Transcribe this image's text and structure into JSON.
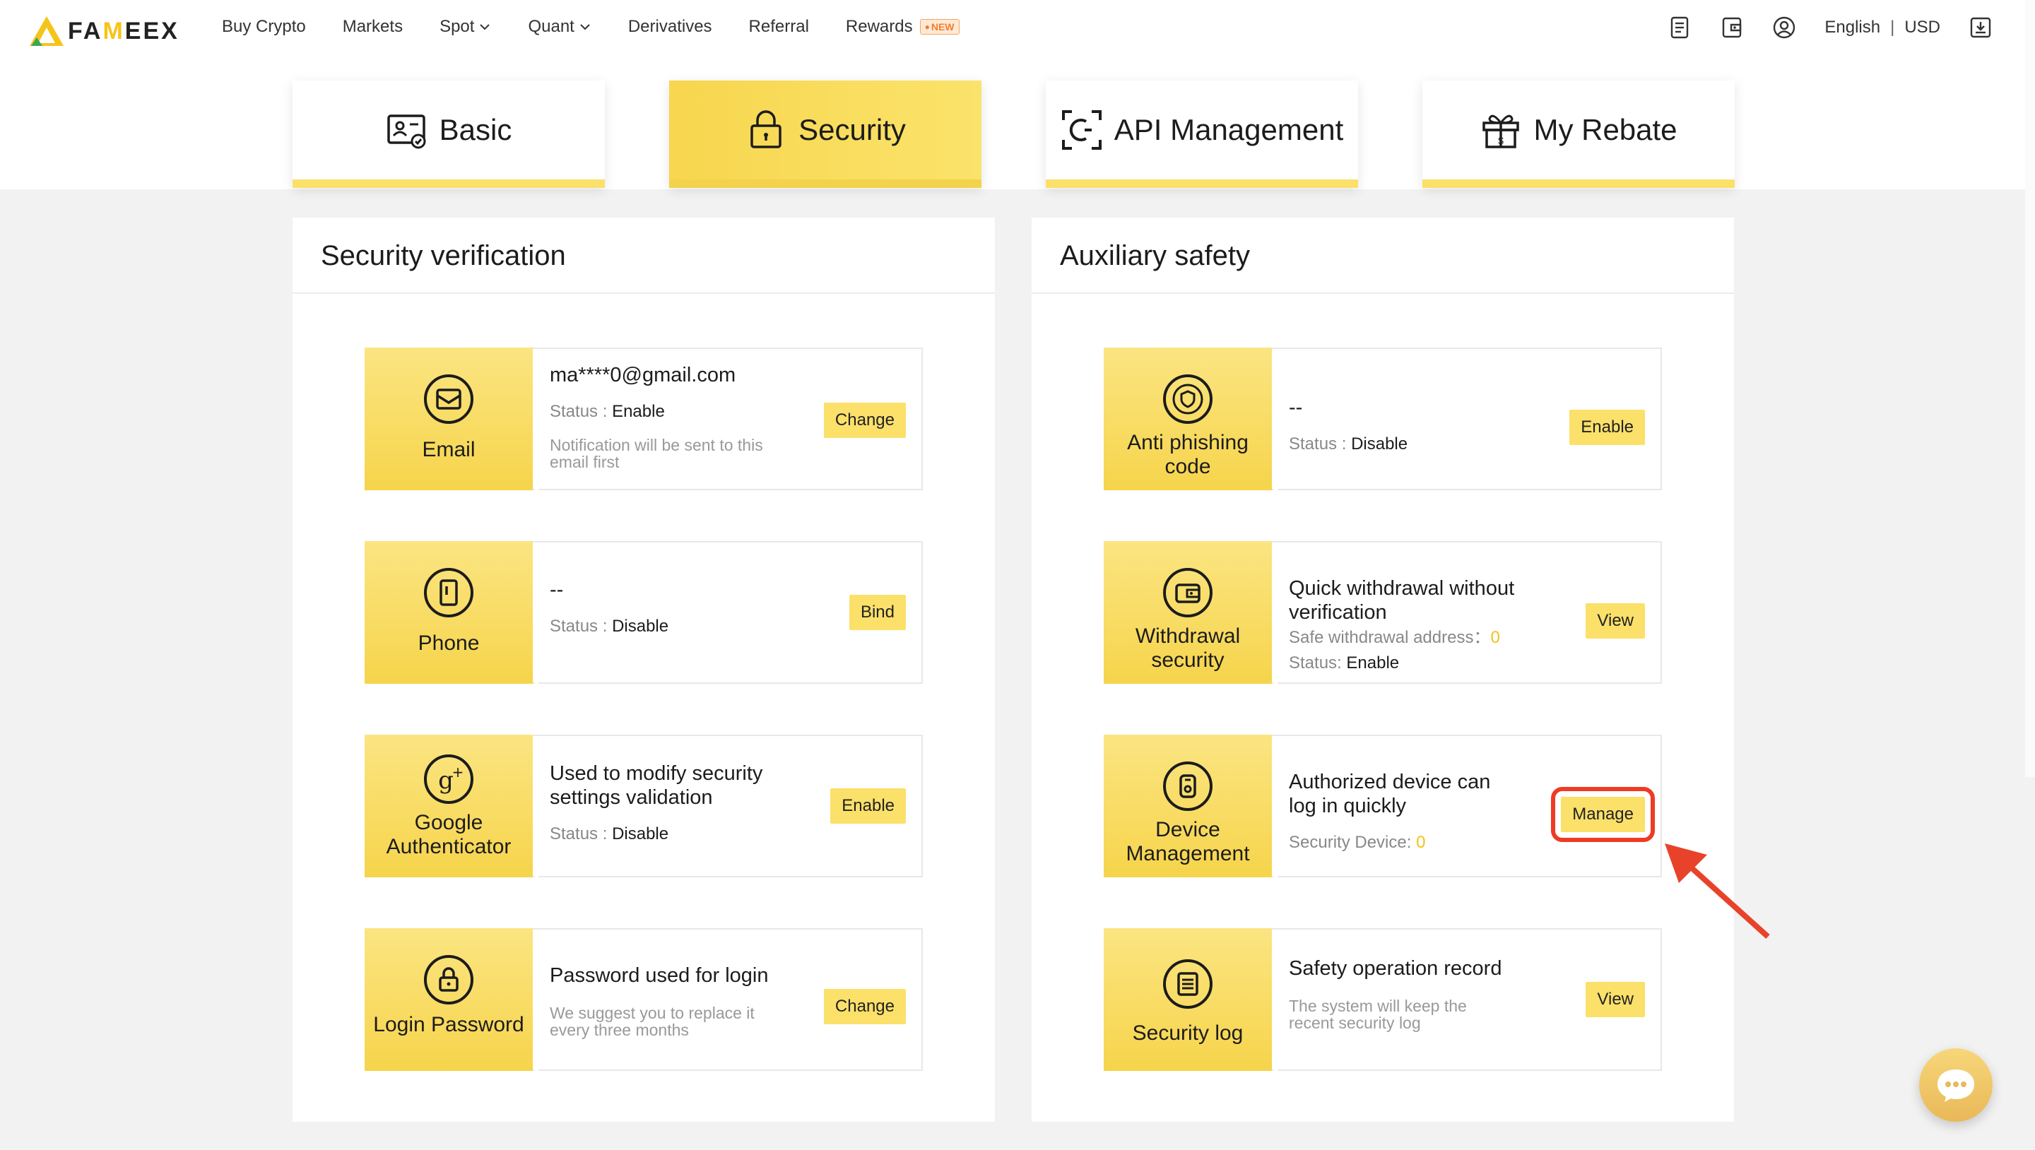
{
  "brand": {
    "name_a": "FA",
    "name_m": "M",
    "name_b": "EEX"
  },
  "nav": {
    "links": [
      {
        "label": "Buy Crypto",
        "dropdown": false
      },
      {
        "label": "Markets",
        "dropdown": false
      },
      {
        "label": "Spot",
        "dropdown": true
      },
      {
        "label": "Quant",
        "dropdown": true
      },
      {
        "label": "Derivatives",
        "dropdown": false
      },
      {
        "label": "Referral",
        "dropdown": false
      },
      {
        "label": "Rewards",
        "dropdown": false
      }
    ],
    "rewards_badge": "NEW",
    "language": "English",
    "separator": "|",
    "currency": "USD",
    "icons": [
      "orders-icon",
      "wallet-icon",
      "account-icon",
      "download-icon"
    ]
  },
  "tabs": [
    {
      "label": "Basic",
      "icon": "id-card-icon",
      "active": false
    },
    {
      "label": "Security",
      "icon": "lock-icon",
      "active": true
    },
    {
      "label": "API Management",
      "icon": "api-scan-icon",
      "active": false
    },
    {
      "label": "My Rebate",
      "icon": "gift-icon",
      "active": false
    }
  ],
  "security_verification": {
    "title": "Security verification",
    "cards": [
      {
        "name": "Email",
        "icon": "email-icon",
        "title": "ma****0@gmail.com",
        "status_label": "Status",
        "status_sep": " : ",
        "status_value": "Enable",
        "note": "Notification will be sent to this email first",
        "button": "Change"
      },
      {
        "name": "Phone",
        "icon": "phone-icon",
        "title": "--",
        "status_label": "Status",
        "status_sep": " : ",
        "status_value": "Disable",
        "note": "",
        "button": "Bind"
      },
      {
        "name": "Google Authenticator",
        "icon": "google-icon",
        "title": "Used to modify security settings validation",
        "status_label": "Status",
        "status_sep": " : ",
        "status_value": "Disable",
        "note": "",
        "button": "Enable"
      },
      {
        "name": "Login Password",
        "icon": "password-lock-icon",
        "title": "Password used for login",
        "status_label": "",
        "status_sep": "",
        "status_value": "",
        "note": "We suggest you to replace it every three months",
        "button": "Change"
      }
    ]
  },
  "auxiliary_safety": {
    "title": "Auxiliary safety",
    "cards": [
      {
        "name": "Anti phishing code",
        "icon": "shield-icon",
        "title": "--",
        "status_label": "Status",
        "status_sep": " : ",
        "status_value": "Disable",
        "button": "Enable"
      },
      {
        "name": "Withdrawal security",
        "icon": "wallet-security-icon",
        "title": "Quick withdrawal without verification",
        "sub_label": "Safe withdrawal address：",
        "sub_value": "0",
        "status_label": "Status",
        "status_sep": ": ",
        "status_value": "Enable",
        "button": "View"
      },
      {
        "name": "Device Management",
        "icon": "device-icon",
        "title": "Authorized device can log in quickly",
        "sub_label": "Security Device: ",
        "sub_value": "0",
        "button": "Manage"
      },
      {
        "name": "Security log",
        "icon": "log-icon",
        "title": "Safety operation record",
        "note": "The system will keep the recent security log",
        "button": "View"
      }
    ]
  },
  "colors": {
    "accent": "#fbe06a",
    "highlight": "#ef3b24",
    "yellow_text": "#f2c21a"
  }
}
